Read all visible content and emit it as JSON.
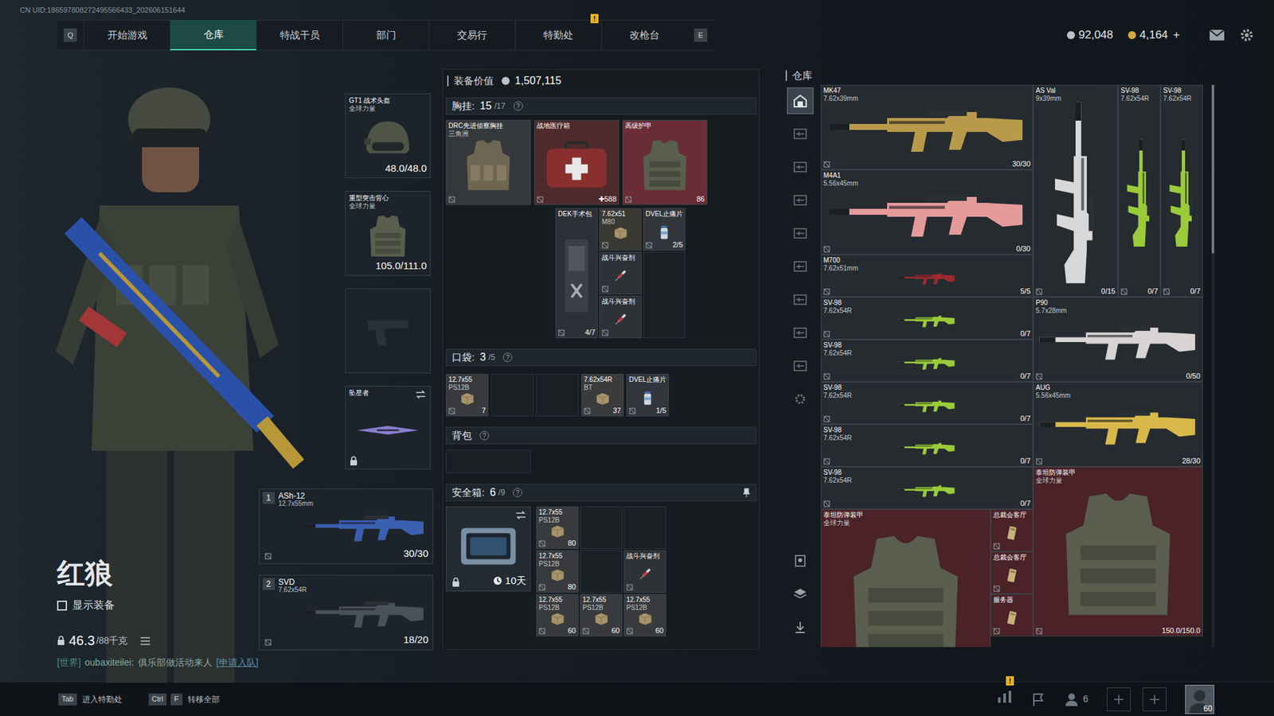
{
  "uid": "CN UID:186597808272495566433_202606151644",
  "nav": {
    "left_key": "Q",
    "right_key": "E",
    "tabs": [
      {
        "label": "开始游戏",
        "selected": false
      },
      {
        "label": "仓库",
        "selected": true
      },
      {
        "label": "特战干员",
        "selected": false
      },
      {
        "label": "部门",
        "selected": false
      },
      {
        "label": "交易行",
        "selected": false
      },
      {
        "label": "特勤处",
        "selected": false,
        "badge": "!"
      },
      {
        "label": "改枪台",
        "selected": false
      }
    ]
  },
  "wallet": [
    {
      "amount": "92,048",
      "kind": "silver"
    },
    {
      "amount": "4,164",
      "action": "+",
      "kind": "gold"
    }
  ],
  "operator": {
    "name": "红狼",
    "show_gear": {
      "label": "显示装备",
      "checked": false
    },
    "weight": "46.3",
    "weight_max": "/88千克"
  },
  "chat": {
    "channel": "[世界]",
    "user": "oubaxiteilei:",
    "message": "俱乐部做活动来人",
    "action": "[申请入队]"
  },
  "slots": {
    "helmet": {
      "name": "GT1 战术头盔",
      "tag": "全球力量",
      "durability": "48.0/48.0"
    },
    "armor": {
      "name": "重型突击背心",
      "tag": "全球力量",
      "durability": "105.0/111.0"
    },
    "melee": {
      "name": "坠星者",
      "locked": true
    },
    "weapons": [
      {
        "slot": "1",
        "name": "ASh-12",
        "caliber": "12.7x55mm",
        "ammo": "30/30"
      },
      {
        "slot": "2",
        "name": "SVD",
        "caliber": "7.62x54R",
        "ammo": "18/20"
      }
    ]
  },
  "loadout": {
    "value_label": "装备价值",
    "value": "1,507,115",
    "chest": {
      "label": "胸挂:",
      "used": "15",
      "capacity": "/17",
      "help": "?",
      "main": [
        {
          "name": "DRC先进侦察胸挂",
          "sub": "三角洲",
          "kind": "rig",
          "color": "#34383b"
        },
        {
          "name": "战地医疗箱",
          "count": "✚588",
          "kind": "med",
          "color": "#4f2a2c"
        },
        {
          "name": "高级护甲",
          "count": "86",
          "kind": "armor",
          "color": "#6a2d36"
        }
      ],
      "grid": [
        {
          "name": "DEK手术包",
          "count": "4/7",
          "kind": "surgery",
          "color": "#2d3036"
        },
        {
          "name": "7.62x51",
          "sub": "M80",
          "kind": "ammo",
          "color": "#3a3833"
        },
        {
          "name": "DVEL止痛片",
          "count": "2/5",
          "kind": "pills",
          "color": "#32363b"
        },
        {
          "name": "战斗兴奋剂",
          "kind": "stim",
          "color": "#2e3136"
        },
        {
          "name": "战斗兴奋剂",
          "kind": "stim",
          "color": "#2e3136"
        },
        {
          "kind": "empty"
        }
      ]
    },
    "pocket": {
      "label": "口袋:",
      "used": "3",
      "capacity": "/5",
      "help": "?",
      "items": [
        {
          "name": "12.7x55",
          "sub": "PS12B",
          "count": "7",
          "kind": "ammo",
          "color": "#383a3d"
        },
        {
          "kind": "empty"
        },
        {
          "kind": "empty"
        },
        {
          "name": "7.62x54R",
          "sub": "BT",
          "count": "37",
          "kind": "ammo",
          "color": "#3a3b3c"
        },
        {
          "name": "DVEL止痛片",
          "count": "1/5",
          "kind": "pills",
          "color": "#32363b"
        }
      ]
    },
    "backpack": {
      "label": "背包",
      "help": "?"
    },
    "safe": {
      "label": "安全箱:",
      "used": "6",
      "capacity": "/9",
      "help": "?",
      "timer": "10天",
      "locked": true,
      "items": [
        {
          "name": "12.7x55",
          "sub": "PS12B",
          "count": "80",
          "kind": "ammo",
          "color": "#383a3d"
        },
        {
          "kind": "empty"
        },
        {
          "kind": "empty"
        },
        {
          "name": "12.7x55",
          "sub": "PS12B",
          "count": "80",
          "kind": "ammo",
          "color": "#383a3d"
        },
        {
          "kind": "empty"
        },
        {
          "name": "战斗兴奋剂",
          "kind": "stim",
          "color": "#2e3136"
        },
        {
          "name": "12.7x55",
          "sub": "PS12B",
          "count": "60",
          "kind": "ammo",
          "color": "#383a3d"
        },
        {
          "name": "12.7x55",
          "sub": "PS12B",
          "count": "60",
          "kind": "ammo",
          "color": "#383a3d"
        },
        {
          "name": "12.7x55",
          "sub": "PS12B",
          "count": "60",
          "kind": "ammo",
          "color": "#383a3d"
        }
      ]
    }
  },
  "warehouse": {
    "title": "仓库",
    "sidebar": [
      {
        "selected": true
      },
      {
        "selected": false
      },
      {
        "selected": false
      },
      {
        "selected": false
      },
      {
        "selected": false
      },
      {
        "selected": false
      },
      {
        "selected": false
      },
      {
        "selected": false
      },
      {
        "selected": false
      }
    ],
    "scroll": {
      "level": 0.3
    },
    "items": [
      {
        "name": "MK47",
        "sub": "7.62x39mm",
        "count": "30/30",
        "kind": "weapon",
        "color": "#262b30"
      },
      {
        "name": "M4A1",
        "sub": "5.56x45mm",
        "count": "0/30",
        "kind": "weapon",
        "color": "#262b30"
      },
      {
        "name": "M700",
        "sub": "7.62x51mm",
        "count": "5/5",
        "kind": "weapon",
        "color": "#262b30"
      },
      {
        "name": "SV-98",
        "sub": "7.62x54R",
        "count": "0/7",
        "kind": "weapon",
        "color": "#262b30"
      },
      {
        "name": "SV-98",
        "sub": "7.62x54R",
        "count": "0/7",
        "kind": "weapon",
        "color": "#262b30"
      },
      {
        "name": "SV-98",
        "sub": "7.62x54R",
        "count": "0/7",
        "kind": "weapon",
        "color": "#262b30"
      },
      {
        "name": "SV-98",
        "sub": "7.62x54R",
        "count": "0/7",
        "kind": "weapon",
        "color": "#262b30"
      },
      {
        "name": "SV-98",
        "sub": "7.62x54R",
        "count": "0/7",
        "kind": "weapon",
        "color": "#262b30"
      },
      {
        "name": "AS Val",
        "sub": "9x39mm",
        "count": "0/15",
        "kind": "weapon",
        "color": "#262b30"
      },
      {
        "name": "SV-98",
        "sub": "7.62x54R",
        "count": "0/7",
        "kind": "weapon",
        "color": "#262b30"
      },
      {
        "name": "SV-98",
        "sub": "7.62x54R",
        "count": "0/7",
        "kind": "weapon",
        "color": "#262b30"
      },
      {
        "name": "P90",
        "sub": "5.7x28mm",
        "count": "0/50",
        "kind": "weapon",
        "color": "#262b30"
      },
      {
        "name": "AUG",
        "sub": "5.56x45mm",
        "count": "28/30",
        "kind": "weapon",
        "color": "#262b30"
      },
      {
        "name": "泰坦防弹装甲",
        "sub": "全球力量",
        "count": "150.0/150.0",
        "kind": "armor",
        "color": "#4a2228"
      },
      {
        "name": "泰坦防弹装甲",
        "sub": "全球力量",
        "kind": "armor",
        "color": "#4a2228"
      },
      {
        "name": "总裁会客厅",
        "kind": "key",
        "color": "#4a2228"
      },
      {
        "name": "总裁会客厅",
        "kind": "key",
        "color": "#4a2228"
      },
      {
        "name": "服务器",
        "kind": "key",
        "color": "#4a2228"
      }
    ]
  },
  "bottom": {
    "keys": [
      {
        "keys": [
          "Tab"
        ],
        "label": "进入特勤处"
      },
      {
        "keys": [
          "Ctrl",
          "F"
        ],
        "label": "转移全部"
      }
    ],
    "alert": "!",
    "friends": "6",
    "level": "60"
  }
}
